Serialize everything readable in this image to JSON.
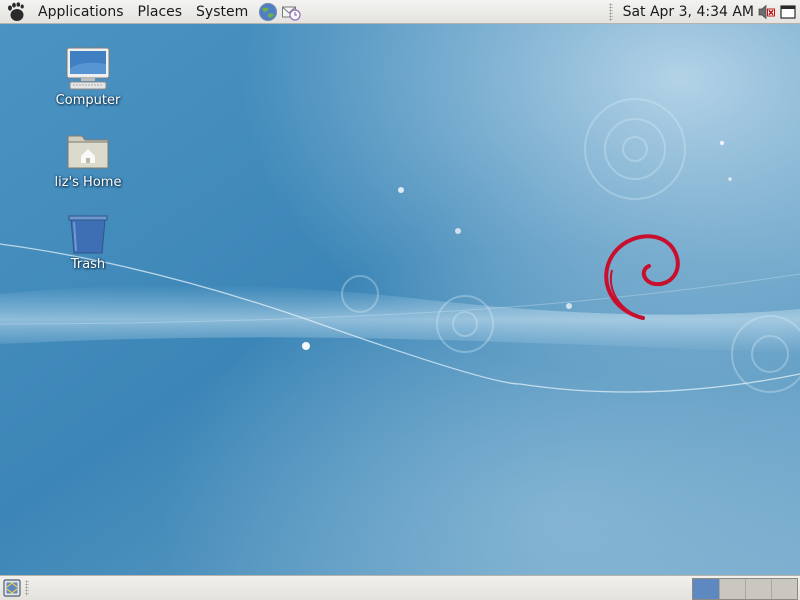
{
  "top_panel": {
    "menus": [
      "Applications",
      "Places",
      "System"
    ],
    "launchers": [
      "web-browser-icon",
      "email-client-icon"
    ],
    "clock": "Sat Apr  3,  4:34 AM",
    "tray": [
      "volume-muted-icon",
      "window-list-icon"
    ]
  },
  "desktop": {
    "icons": [
      {
        "label": "Computer",
        "icon": "computer-icon"
      },
      {
        "label": "liz's Home",
        "icon": "home-folder-icon"
      },
      {
        "label": "Trash",
        "icon": "trash-icon"
      }
    ]
  },
  "bottom_panel": {
    "show_desktop_icon": "show-desktop-icon",
    "workspaces": [
      {
        "active": true
      },
      {
        "active": false
      },
      {
        "active": false
      },
      {
        "active": false
      }
    ]
  },
  "colors": {
    "wallpaper_base": "#3a7fae",
    "debian_swirl": "#c8102e",
    "panel": "#e9e8e4",
    "active_workspace": "#5d89c0"
  }
}
